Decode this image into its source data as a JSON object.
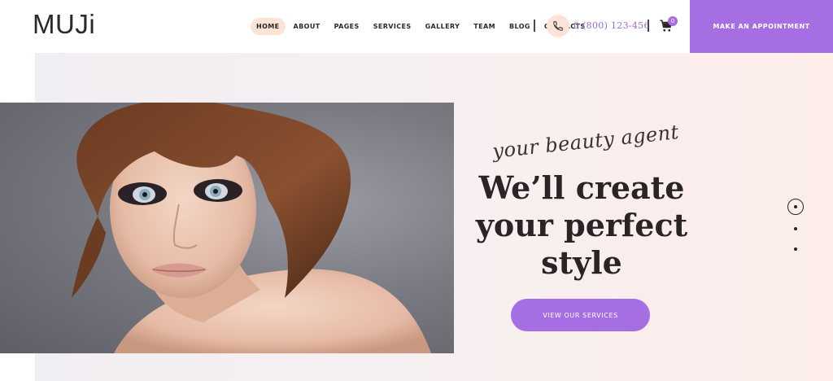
{
  "brand": {
    "logo_text": "MUJi"
  },
  "nav": {
    "items": [
      {
        "label": "HOME",
        "active": true
      },
      {
        "label": "ABOUT",
        "active": false
      },
      {
        "label": "PAGES",
        "active": false
      },
      {
        "label": "SERVICES",
        "active": false
      },
      {
        "label": "GALLERY",
        "active": false
      },
      {
        "label": "TEAM",
        "active": false
      },
      {
        "label": "BLOG",
        "active": false
      },
      {
        "label": "CONTACTS",
        "active": false
      }
    ]
  },
  "contact": {
    "phone": "0 (800) 123-456",
    "icon": "phone-icon"
  },
  "cart": {
    "count": "0",
    "icon": "cart-icon"
  },
  "header_cta": {
    "label": "MAKE AN APPOINTMENT"
  },
  "hero": {
    "tagline": "your beauty agent",
    "headline_line1": "We’ll create",
    "headline_line2": "your perfect",
    "headline_line3": "style",
    "button_label": "VIEW OUR SERVICES",
    "image": "portrait-photo"
  },
  "slider": {
    "total": 3,
    "active_index": 0
  },
  "colors": {
    "accent": "#a56ee3",
    "highlight": "#fbe3d6",
    "text": "#2b2424",
    "phone_text": "#9b6ad6"
  }
}
